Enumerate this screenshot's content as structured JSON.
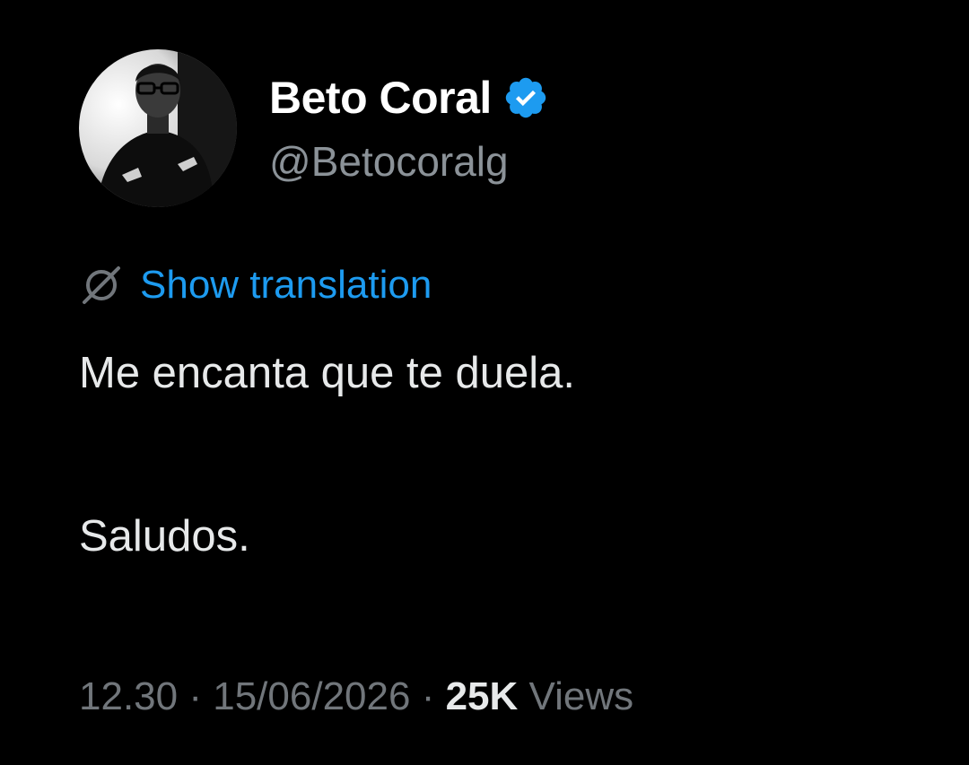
{
  "profile": {
    "display_name": "Beto Coral",
    "handle": "@Betocoralg",
    "avatar_icon": "profile-photo",
    "verified_icon": "verified-badge-icon",
    "verified_color": "#1d9bf0"
  },
  "translation": {
    "icon": "translate-icon",
    "label": "Show translation",
    "link_color": "#1d9bf0"
  },
  "tweet": {
    "lines": [
      "Me encanta que te duela.",
      "Saludos."
    ]
  },
  "meta": {
    "time": "12.30",
    "separator": "·",
    "date": "15/06/2026",
    "views_count": "25K",
    "views_label": "Views"
  }
}
